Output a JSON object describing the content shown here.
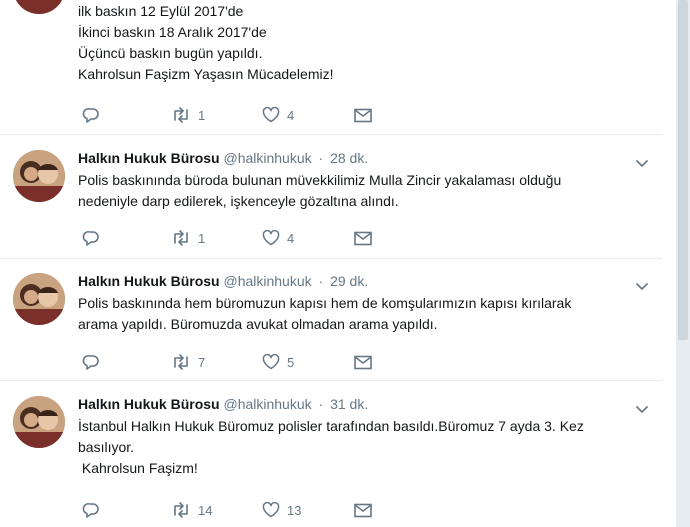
{
  "tweets": [
    {
      "name": "",
      "handle": "",
      "time": "",
      "lines": [
        "ilk baskın 12 Eylül 2017'de",
        "İkinci baskın 18 Aralık 2017'de",
        "Üçüncü baskın bugün yapıldı.",
        "Kahrolsun Faşizm Yaşasın Mücadelemiz!"
      ],
      "retweets": "1",
      "likes": "4"
    },
    {
      "name": "Halkın Hukuk Bürosu",
      "handle": "@halkinhukuk",
      "time": "28 dk.",
      "lines": [
        "Polis baskınında büroda bulunan müvekkilimiz Mulla Zincir yakalaması olduğu",
        "nedeniyle darp edilerek, işkenceyle gözaltına alındı."
      ],
      "retweets": "1",
      "likes": "4"
    },
    {
      "name": "Halkın Hukuk Bürosu",
      "handle": "@halkinhukuk",
      "time": "29 dk.",
      "lines": [
        "Polis baskınında hem büromuzun kapısı hem de komşularımızın kapısı kırılarak",
        "arama yapıldı. Büromuzda avukat olmadan arama yapıldı."
      ],
      "retweets": "7",
      "likes": "5"
    },
    {
      "name": "Halkın Hukuk Bürosu",
      "handle": "@halkinhukuk",
      "time": "31 dk.",
      "lines": [
        "İstanbul Halkın Hukuk Büromuz polisler tarafından basıldı.Büromuz 7 ayda 3. Kez",
        "basılıyor.",
        " Kahrolsun Faşizm!"
      ],
      "retweets": "14",
      "likes": "13"
    }
  ],
  "separator": "·",
  "icons": {
    "reply": "reply-icon",
    "retweet": "retweet-icon",
    "like": "heart-icon",
    "message": "envelope-icon",
    "caret": "chevron-down-icon"
  },
  "colors": {
    "text": "#14171a",
    "secondary": "#657786",
    "border": "#e6ecf0",
    "background": "#ffffff"
  }
}
